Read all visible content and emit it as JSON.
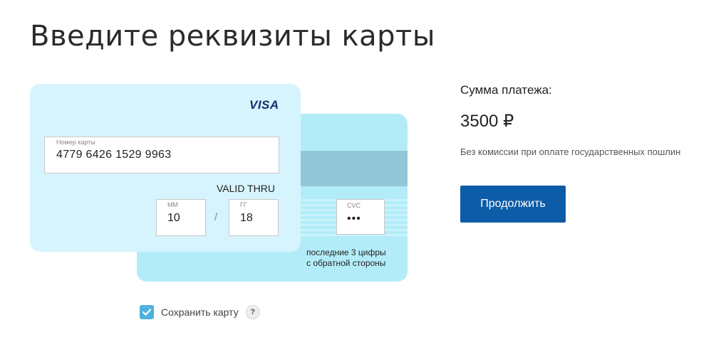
{
  "page": {
    "title": "Введите реквизиты карты"
  },
  "card_front": {
    "brand": "VISA",
    "number_label": "Номер карты",
    "number_value": "4779 6426 1529 9963",
    "valid_thru_label": "VALID THRU",
    "month_label": "ММ",
    "month_value": "10",
    "separator": "/",
    "year_label": "ГГ",
    "year_value": "18"
  },
  "card_back": {
    "cvc_label": "CVC",
    "cvc_value": "•••",
    "cvc_hint_line1": "последние 3 цифры",
    "cvc_hint_line2": "с обратной стороны"
  },
  "save_card": {
    "checked": true,
    "label": "Сохранить карту",
    "help": "?"
  },
  "payment": {
    "amount_label": "Сумма платежа:",
    "amount_value": "3500 ₽",
    "note": "Без комиссии при оплате государственных пошлин",
    "continue_label": "Продолжить"
  },
  "colors": {
    "front_card": "#d6f4fd",
    "back_card": "#b3ecf9",
    "magstripe": "#93c7d8",
    "checkbox": "#4fb2de",
    "button": "#0d5ca7",
    "visa": "#1a2d6e"
  }
}
